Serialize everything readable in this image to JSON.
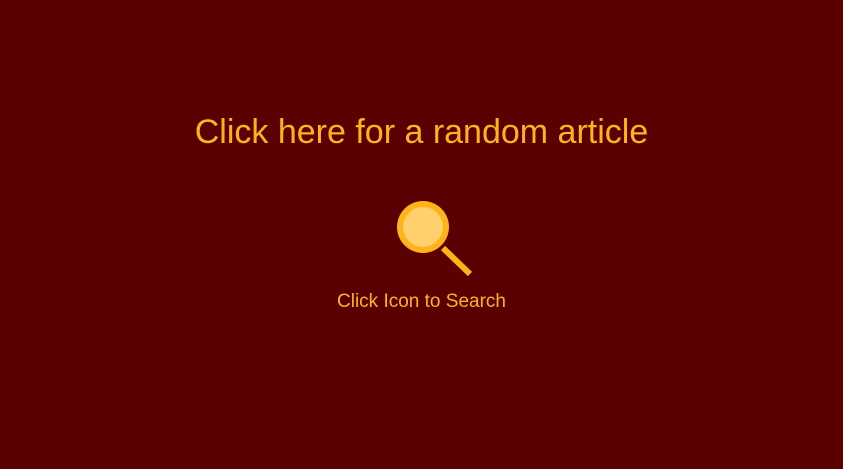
{
  "main": {
    "random_article_label": "Click here for a random article",
    "search_caption": "Click Icon to Search",
    "search_icon": "magnifying-glass"
  },
  "colors": {
    "background": "#5a0000",
    "accent": "#ffb31a",
    "lens_fill": "#ffd06b"
  }
}
